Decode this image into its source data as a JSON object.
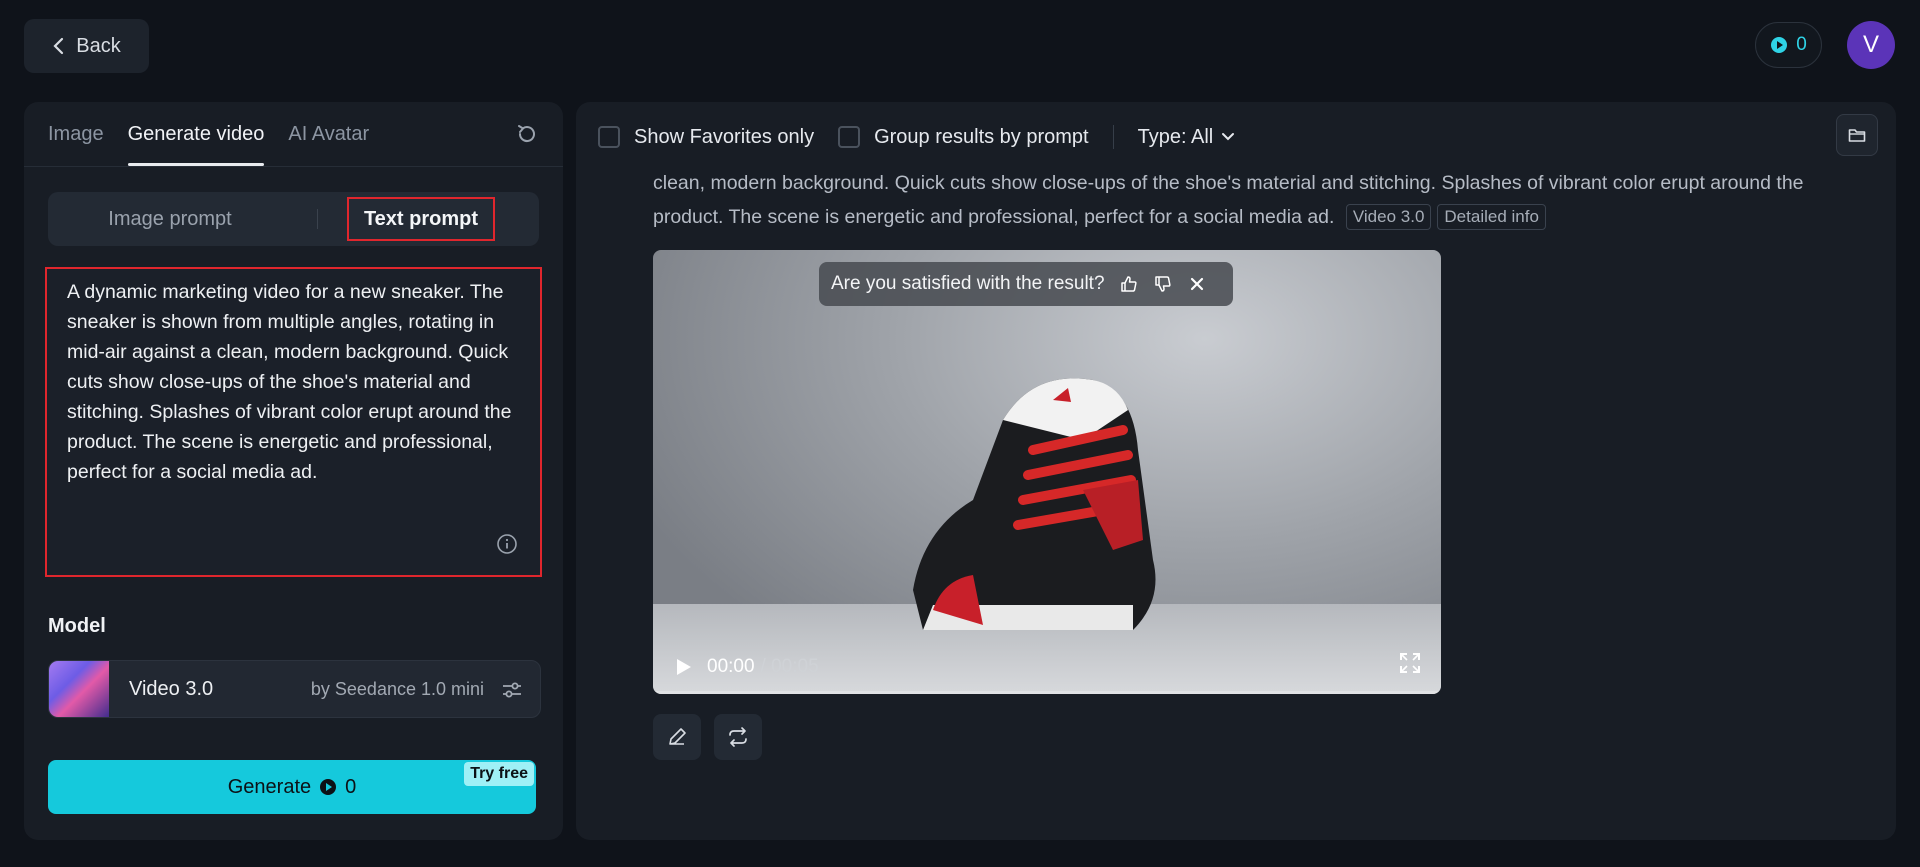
{
  "header": {
    "back_label": "Back",
    "credits": "0",
    "avatar_initial": "V"
  },
  "left": {
    "tabs": [
      {
        "label": "Image"
      },
      {
        "label": "Generate video"
      },
      {
        "label": "AI Avatar"
      }
    ],
    "prompt_modes": {
      "image": "Image prompt",
      "text": "Text prompt"
    },
    "prompt_text": "A dynamic marketing video for a new sneaker. The sneaker is shown from multiple angles, rotating in mid-air against a clean, modern background. Quick cuts show close-ups of the shoe's material and stitching. Splashes of vibrant color erupt around the product. The scene is energetic and professional, perfect for a social media ad.",
    "model_label": "Model",
    "model": {
      "name": "Video 3.0",
      "by": "by Seedance 1.0 mini"
    },
    "generate": {
      "label": "Generate",
      "cost": "0",
      "badge": "Try free"
    }
  },
  "right": {
    "toolbar": {
      "favorites_label": "Show Favorites only",
      "group_label": "Group results by prompt",
      "type_label": "Type: All"
    },
    "result": {
      "text": "clean, modern background. Quick cuts show close-ups of the shoe's material and stitching. Splashes of vibrant color erupt around the product. The scene is energetic and professional, perfect for a social media ad.",
      "chip_model": "Video 3.0",
      "chip_info": "Detailed info"
    },
    "video": {
      "feedback_question": "Are you satisfied with the result?",
      "time_current": "00:00",
      "time_total": "/ 00:05",
      "progress": 0
    }
  },
  "colors": {
    "accent": "#15c9dc",
    "highlight": "#e0262d",
    "avatar": "#5b34b8"
  }
}
